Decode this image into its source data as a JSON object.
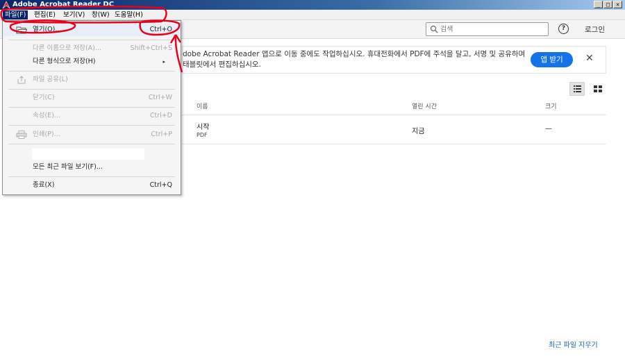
{
  "window": {
    "title": "Adobe Acrobat Reader DC",
    "controls": [
      "_",
      "□",
      "×"
    ]
  },
  "menubar": {
    "items": [
      "파일(F)",
      "편집(E)",
      "보기(V)",
      "창(W)",
      "도움말(H)"
    ]
  },
  "toolbar": {
    "search_placeholder": "검색",
    "help_label": "?",
    "login_label": "로그인"
  },
  "banner": {
    "text": "dobe Acrobat Reader 앱으로 이동 중에도 작업하십시오. 휴대전화에서 PDF에 주석을 달고, 서명 및 공유하며 태블릿에서 편집하십시오.",
    "button_label": "앱 받기",
    "close_glyph": "✕"
  },
  "table": {
    "columns": [
      "이름",
      "열린 시간",
      "크기"
    ],
    "rows": [
      {
        "name": "시작",
        "type": "PDF",
        "opened": "지금",
        "size": "—"
      }
    ]
  },
  "clear_recent_label": "최근 파일 지우기",
  "file_menu": {
    "open": {
      "label": "열기(O)...",
      "shortcut": "Ctrl+O"
    },
    "save_as": {
      "label": "다른 이름으로 저장(A)...",
      "shortcut": "Shift+Ctrl+S"
    },
    "save_as_other": {
      "label": "다른 형식으로 저장(H)",
      "arrow": "▸"
    },
    "share": {
      "label": "파일 공유(L)"
    },
    "close": {
      "label": "닫기(C)",
      "shortcut": "Ctrl+W"
    },
    "properties": {
      "label": "속성(E)...",
      "shortcut": "Ctrl+D"
    },
    "print": {
      "label": "인쇄(P)...",
      "shortcut": "Ctrl+P"
    },
    "view_recent": {
      "label": "모든 최근 파일 보기(F)..."
    },
    "exit": {
      "label": "종료(X)",
      "shortcut": "Ctrl+Q"
    }
  },
  "colors": {
    "accent": "#1473e6",
    "menu_highlight": "#0a246a",
    "annotation": "#e8001c",
    "link": "#1a5fb4"
  }
}
